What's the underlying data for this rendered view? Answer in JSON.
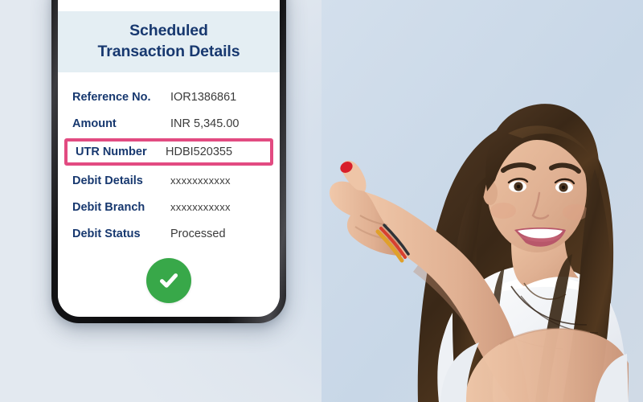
{
  "background": {
    "color": "#dfe6ee"
  },
  "device": {
    "name": "smartphone-mockup",
    "frame_color": "#111113"
  },
  "app": {
    "header": {
      "line1": "Scheduled",
      "line2": "Transaction Details",
      "band_color": "#e4eef3",
      "text_color": "#17386f"
    },
    "details": [
      {
        "label": "Reference No.",
        "value": "IOR1386861",
        "highlighted": false,
        "masked": false
      },
      {
        "label": "Amount",
        "value": "INR 5,345.00",
        "highlighted": false,
        "masked": false
      },
      {
        "label": "UTR Number",
        "value": "HDBI520355",
        "highlighted": true,
        "masked": false
      },
      {
        "label": "Debit Details",
        "value": "xxxxxxxxxxx",
        "highlighted": false,
        "masked": true
      },
      {
        "label": "Debit Branch",
        "value": "xxxxxxxxxxx",
        "highlighted": false,
        "masked": true
      },
      {
        "label": "Debit Status",
        "value": "Processed",
        "highlighted": false,
        "masked": false
      }
    ],
    "highlight_color": "#e24b81",
    "label_color": "#17386f",
    "value_color": "#3b3b3b",
    "confirm_button": {
      "icon": "check-icon",
      "circle_color": "#38a849",
      "icon_color": "#ffffff"
    }
  },
  "photo": {
    "subject": "smiling-woman-pointing-left",
    "hair_color": "#43301f",
    "skin_color": "#e3b595",
    "top_color": "#f4f6f8",
    "nail_color": "#d81f2a",
    "backdrop_color": "#ccd9e8"
  }
}
